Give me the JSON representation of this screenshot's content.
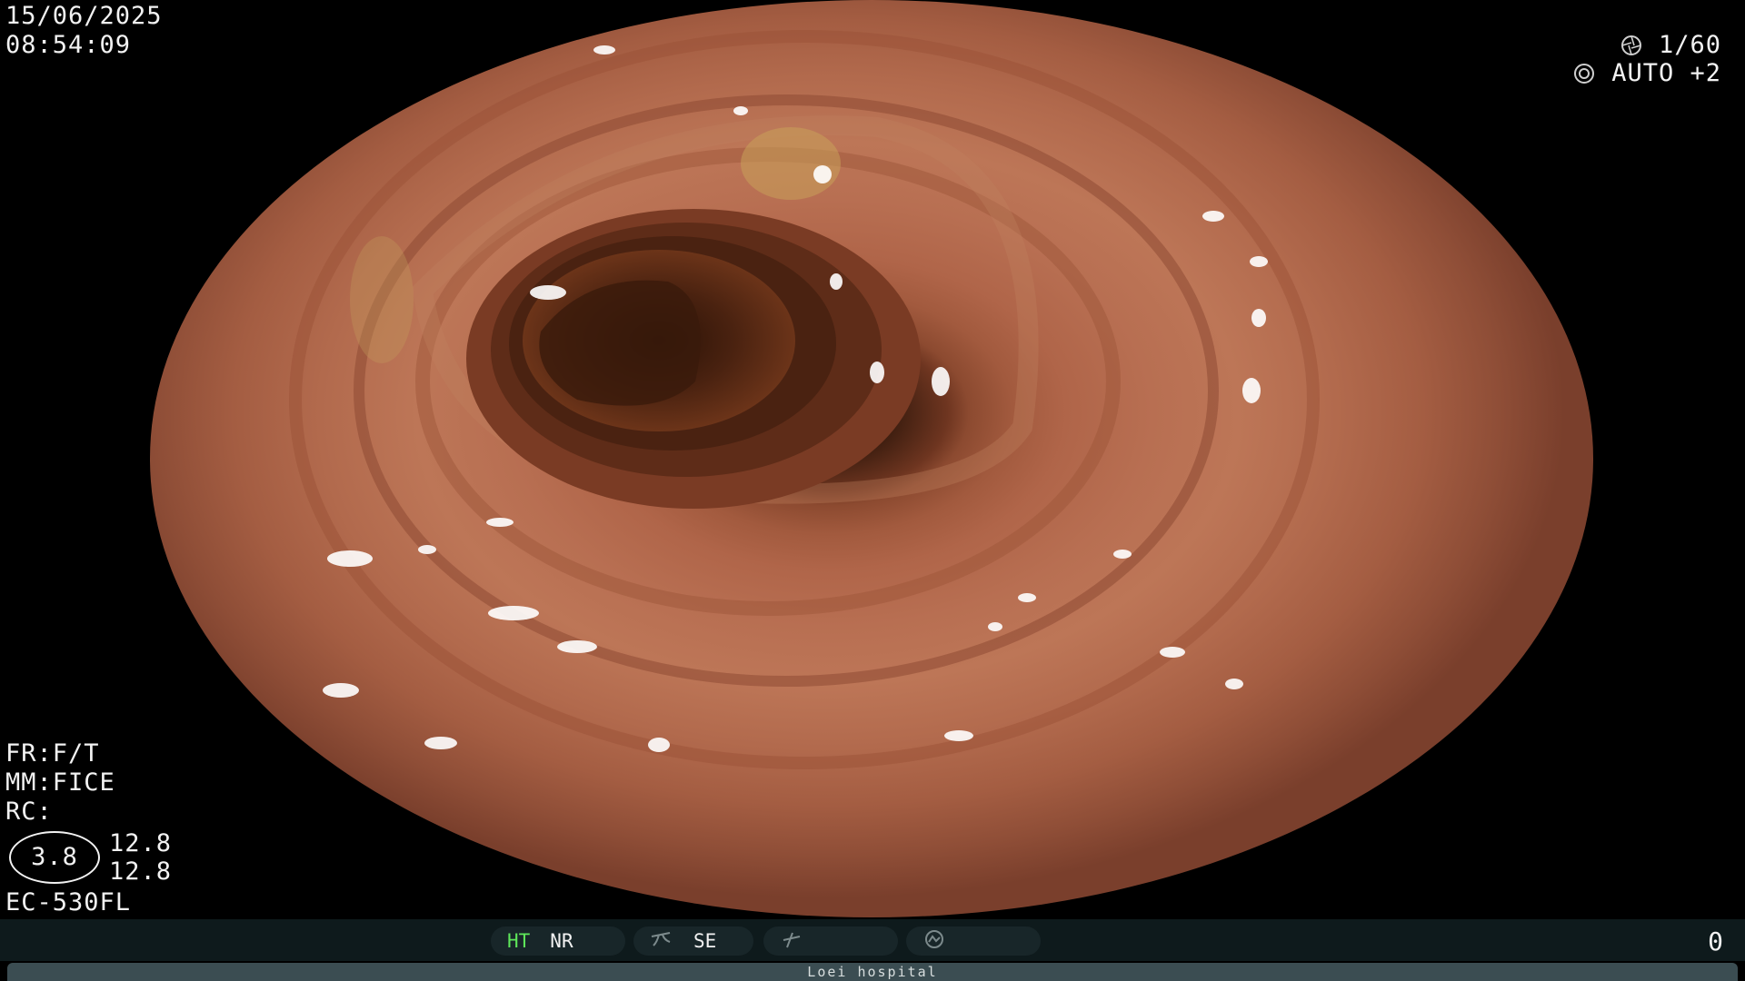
{
  "datetime": {
    "date": "15/06/2025",
    "time": "08:54:09"
  },
  "exposure": {
    "shutter": "1/60",
    "mode": "AUTO +2"
  },
  "settings": {
    "fr": "FR:F/T",
    "mm": "MM:FICE",
    "rc": "RC:",
    "zoom": "3.8",
    "value_1": "12.8",
    "value_2": "12.8",
    "model": "EC-530FL"
  },
  "status": {
    "ht": "HT",
    "nr": "NR",
    "se": "SE",
    "counter": "0"
  },
  "footer": {
    "hospital": "Loei hospital"
  },
  "icons": [
    "aperture-icon",
    "iris-icon",
    "enhancement-icon",
    "freeze-icon",
    "capture-icon"
  ],
  "colors": {
    "ht_active": "#5ee65a",
    "status_bar": "#0e1a1c",
    "footer_bar": "#3b4d52"
  }
}
